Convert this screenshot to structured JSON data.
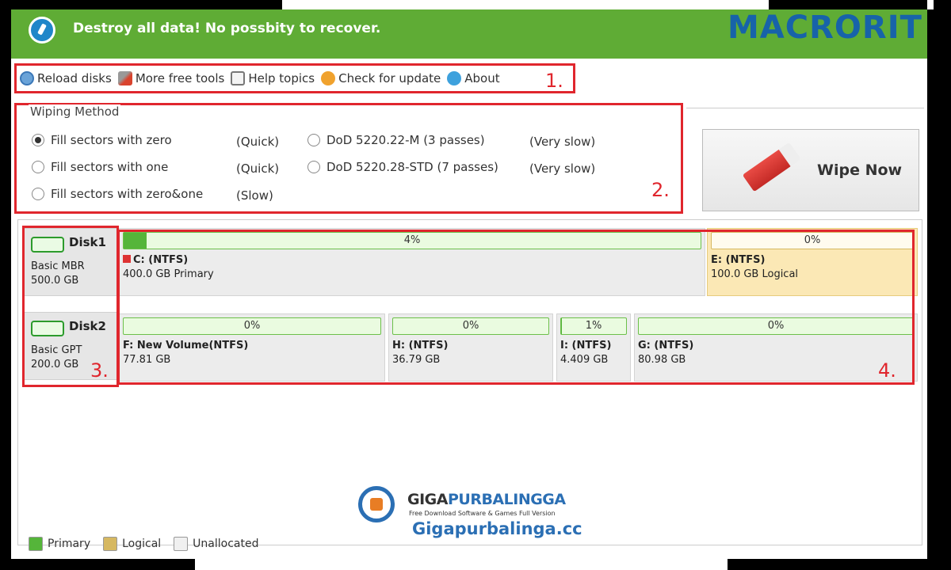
{
  "header": {
    "title": "Destroy all data! No possbity to recover.",
    "brand": "MACRORIT",
    "color": "#5fac35"
  },
  "toolbar": {
    "items": [
      {
        "label": "Reload disks",
        "icon": "reload-icon"
      },
      {
        "label": "More free tools",
        "icon": "tools-icon"
      },
      {
        "label": "Help topics",
        "icon": "help-icon"
      },
      {
        "label": "Check for update",
        "icon": "update-icon"
      },
      {
        "label": "About",
        "icon": "info-icon"
      }
    ]
  },
  "annotations": {
    "n1": "1.",
    "n2": "2.",
    "n3": "3.",
    "n4": "4."
  },
  "wiping": {
    "legend": "Wiping Method",
    "options": [
      {
        "label": "Fill sectors with zero",
        "speed": "(Quick)",
        "checked": true
      },
      {
        "label": "Fill sectors with one",
        "speed": "(Quick)",
        "checked": false
      },
      {
        "label": "Fill sectors with zero&one",
        "speed": "(Slow)",
        "checked": false
      },
      {
        "label": "DoD 5220.22-M (3 passes)",
        "speed": "(Very slow)",
        "checked": false
      },
      {
        "label": "DoD 5220.28-STD (7 passes)",
        "speed": "(Very slow)",
        "checked": false
      }
    ]
  },
  "wipe_button": {
    "label": "Wipe Now",
    "icon": "eraser-icon"
  },
  "disks": [
    {
      "name": "Disk1",
      "type": "Basic MBR",
      "size": "500.0 GB",
      "partitions": [
        {
          "percent": "4%",
          "used": 0.04,
          "label": "C: (NTFS)",
          "sub": "400.0 GB Primary",
          "kind": "primary",
          "flag": true
        },
        {
          "percent": "0%",
          "used": 0.0,
          "label": "E: (NTFS)",
          "sub": "100.0 GB Logical",
          "kind": "logical"
        }
      ]
    },
    {
      "name": "Disk2",
      "type": "Basic GPT",
      "size": "200.0 GB",
      "partitions": [
        {
          "percent": "0%",
          "used": 0.0,
          "label": "F: New Volume(NTFS)",
          "sub": "77.81 GB",
          "kind": "primary"
        },
        {
          "percent": "0%",
          "used": 0.0,
          "label": "H: (NTFS)",
          "sub": "36.79 GB",
          "kind": "primary"
        },
        {
          "percent": "1%",
          "used": 0.01,
          "label": "I: (NTFS)",
          "sub": "4.409 GB",
          "kind": "primary"
        },
        {
          "percent": "0%",
          "used": 0.0,
          "label": "G: (NTFS)",
          "sub": "80.98 GB",
          "kind": "primary"
        }
      ]
    }
  ],
  "watermark": {
    "title_a": "GIGA",
    "title_b": "PURBALINGGA",
    "tagline": "Free Download Software & Games Full Version",
    "url": "Gigapurbalinga.cc"
  },
  "legend": [
    {
      "label": "Primary",
      "color": "#55b53a"
    },
    {
      "label": "Logical",
      "color": "#d6b861"
    },
    {
      "label": "Unallocated",
      "color": "#f0f0f0"
    }
  ]
}
